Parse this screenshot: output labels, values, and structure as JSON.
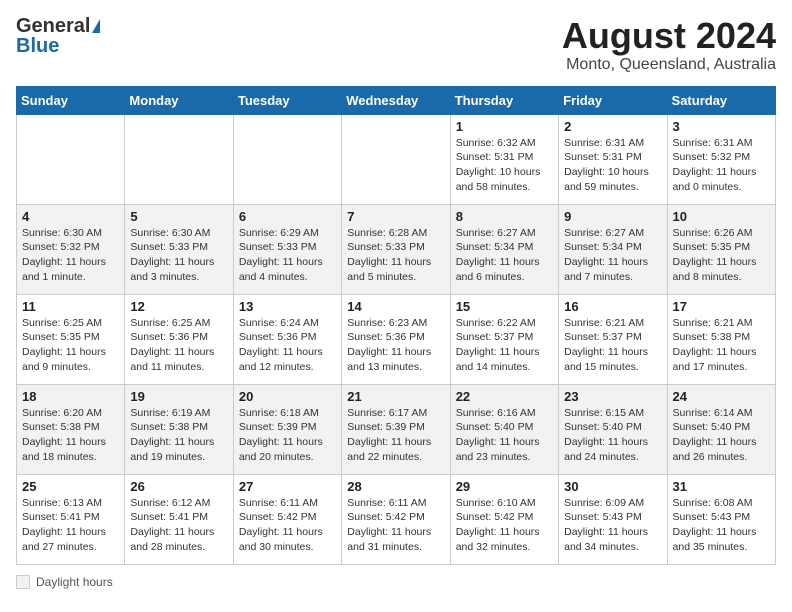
{
  "header": {
    "logo_general": "General",
    "logo_blue": "Blue",
    "month_title": "August 2024",
    "location": "Monto, Queensland, Australia"
  },
  "days_of_week": [
    "Sunday",
    "Monday",
    "Tuesday",
    "Wednesday",
    "Thursday",
    "Friday",
    "Saturday"
  ],
  "weeks": [
    [
      {
        "day": "",
        "info": ""
      },
      {
        "day": "",
        "info": ""
      },
      {
        "day": "",
        "info": ""
      },
      {
        "day": "",
        "info": ""
      },
      {
        "day": "1",
        "info": "Sunrise: 6:32 AM\nSunset: 5:31 PM\nDaylight: 10 hours and 58 minutes."
      },
      {
        "day": "2",
        "info": "Sunrise: 6:31 AM\nSunset: 5:31 PM\nDaylight: 10 hours and 59 minutes."
      },
      {
        "day": "3",
        "info": "Sunrise: 6:31 AM\nSunset: 5:32 PM\nDaylight: 11 hours and 0 minutes."
      }
    ],
    [
      {
        "day": "4",
        "info": "Sunrise: 6:30 AM\nSunset: 5:32 PM\nDaylight: 11 hours and 1 minute."
      },
      {
        "day": "5",
        "info": "Sunrise: 6:30 AM\nSunset: 5:33 PM\nDaylight: 11 hours and 3 minutes."
      },
      {
        "day": "6",
        "info": "Sunrise: 6:29 AM\nSunset: 5:33 PM\nDaylight: 11 hours and 4 minutes."
      },
      {
        "day": "7",
        "info": "Sunrise: 6:28 AM\nSunset: 5:33 PM\nDaylight: 11 hours and 5 minutes."
      },
      {
        "day": "8",
        "info": "Sunrise: 6:27 AM\nSunset: 5:34 PM\nDaylight: 11 hours and 6 minutes."
      },
      {
        "day": "9",
        "info": "Sunrise: 6:27 AM\nSunset: 5:34 PM\nDaylight: 11 hours and 7 minutes."
      },
      {
        "day": "10",
        "info": "Sunrise: 6:26 AM\nSunset: 5:35 PM\nDaylight: 11 hours and 8 minutes."
      }
    ],
    [
      {
        "day": "11",
        "info": "Sunrise: 6:25 AM\nSunset: 5:35 PM\nDaylight: 11 hours and 9 minutes."
      },
      {
        "day": "12",
        "info": "Sunrise: 6:25 AM\nSunset: 5:36 PM\nDaylight: 11 hours and 11 minutes."
      },
      {
        "day": "13",
        "info": "Sunrise: 6:24 AM\nSunset: 5:36 PM\nDaylight: 11 hours and 12 minutes."
      },
      {
        "day": "14",
        "info": "Sunrise: 6:23 AM\nSunset: 5:36 PM\nDaylight: 11 hours and 13 minutes."
      },
      {
        "day": "15",
        "info": "Sunrise: 6:22 AM\nSunset: 5:37 PM\nDaylight: 11 hours and 14 minutes."
      },
      {
        "day": "16",
        "info": "Sunrise: 6:21 AM\nSunset: 5:37 PM\nDaylight: 11 hours and 15 minutes."
      },
      {
        "day": "17",
        "info": "Sunrise: 6:21 AM\nSunset: 5:38 PM\nDaylight: 11 hours and 17 minutes."
      }
    ],
    [
      {
        "day": "18",
        "info": "Sunrise: 6:20 AM\nSunset: 5:38 PM\nDaylight: 11 hours and 18 minutes."
      },
      {
        "day": "19",
        "info": "Sunrise: 6:19 AM\nSunset: 5:38 PM\nDaylight: 11 hours and 19 minutes."
      },
      {
        "day": "20",
        "info": "Sunrise: 6:18 AM\nSunset: 5:39 PM\nDaylight: 11 hours and 20 minutes."
      },
      {
        "day": "21",
        "info": "Sunrise: 6:17 AM\nSunset: 5:39 PM\nDaylight: 11 hours and 22 minutes."
      },
      {
        "day": "22",
        "info": "Sunrise: 6:16 AM\nSunset: 5:40 PM\nDaylight: 11 hours and 23 minutes."
      },
      {
        "day": "23",
        "info": "Sunrise: 6:15 AM\nSunset: 5:40 PM\nDaylight: 11 hours and 24 minutes."
      },
      {
        "day": "24",
        "info": "Sunrise: 6:14 AM\nSunset: 5:40 PM\nDaylight: 11 hours and 26 minutes."
      }
    ],
    [
      {
        "day": "25",
        "info": "Sunrise: 6:13 AM\nSunset: 5:41 PM\nDaylight: 11 hours and 27 minutes."
      },
      {
        "day": "26",
        "info": "Sunrise: 6:12 AM\nSunset: 5:41 PM\nDaylight: 11 hours and 28 minutes."
      },
      {
        "day": "27",
        "info": "Sunrise: 6:11 AM\nSunset: 5:42 PM\nDaylight: 11 hours and 30 minutes."
      },
      {
        "day": "28",
        "info": "Sunrise: 6:11 AM\nSunset: 5:42 PM\nDaylight: 11 hours and 31 minutes."
      },
      {
        "day": "29",
        "info": "Sunrise: 6:10 AM\nSunset: 5:42 PM\nDaylight: 11 hours and 32 minutes."
      },
      {
        "day": "30",
        "info": "Sunrise: 6:09 AM\nSunset: 5:43 PM\nDaylight: 11 hours and 34 minutes."
      },
      {
        "day": "31",
        "info": "Sunrise: 6:08 AM\nSunset: 5:43 PM\nDaylight: 11 hours and 35 minutes."
      }
    ]
  ],
  "footer": {
    "daylight_label": "Daylight hours"
  }
}
